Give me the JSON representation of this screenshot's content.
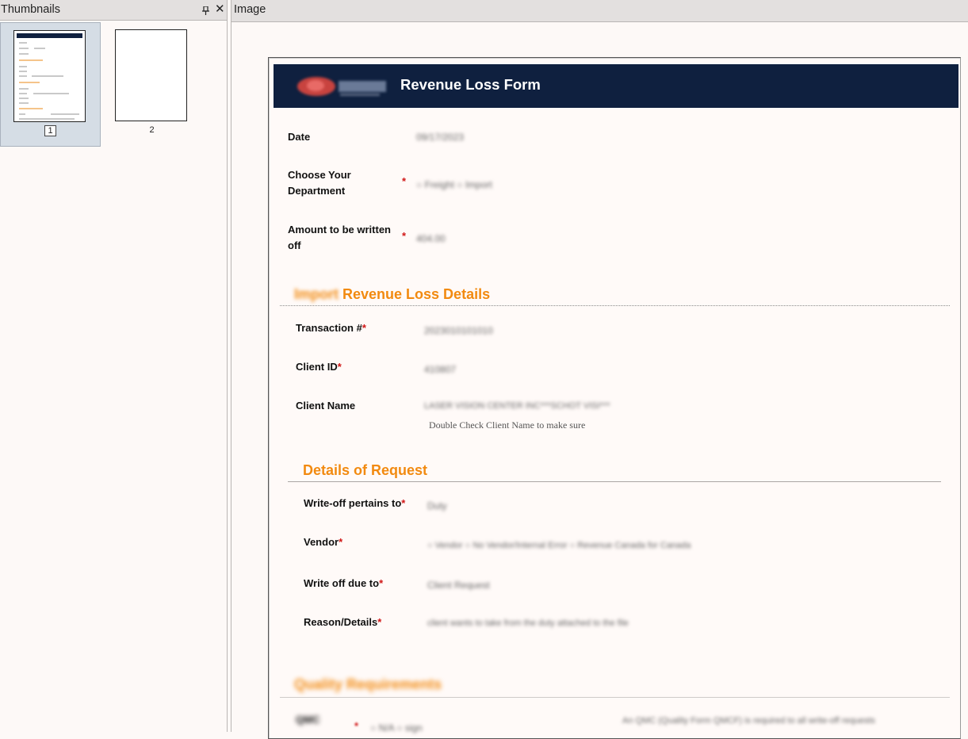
{
  "thumbnails_pane": {
    "title": "Thumbnails",
    "pin_icon": "pin-icon",
    "close_icon": "close-icon",
    "pages": [
      {
        "number": "1",
        "selected": true
      },
      {
        "number": "2",
        "selected": false
      }
    ]
  },
  "image_pane": {
    "title": "Image"
  },
  "form": {
    "title": "Revenue Loss Form",
    "colors": {
      "banner": "#0f203f",
      "section": "#f28a10",
      "required": "#d01616"
    },
    "fields_top": [
      {
        "label": "Date",
        "value": "09/17/2023",
        "required": false
      },
      {
        "label": "Choose Your Department",
        "value": "○ Freight  ○ Import",
        "required": true
      },
      {
        "label": "Amount to be written off",
        "value": "404.00",
        "required": true
      }
    ],
    "section1": {
      "prefix": "Import",
      "title": "Revenue Loss Details",
      "fields": [
        {
          "label": "Transaction #",
          "value": "2023010101010",
          "required": true
        },
        {
          "label": "Client ID",
          "value": "410807",
          "required": true
        },
        {
          "label": "Client Name",
          "value": "LASER VISION CENTER INC***SCHOT VISI***",
          "required": false,
          "hint": "Double Check Client Name to make sure"
        }
      ]
    },
    "section2": {
      "title": "Details of Request",
      "fields": [
        {
          "label": "Write-off pertains to",
          "value": "Duty",
          "required": true
        },
        {
          "label": "Vendor",
          "value": "○ Vendor   ○ No Vendor/Internal Error   ○ Revenue Canada for Canada",
          "required": true
        },
        {
          "label": "Write off due to",
          "value": "Client Request",
          "required": true
        },
        {
          "label": "Reason/Details",
          "value": "client wants to take from the duty attached to the file",
          "required": true
        }
      ]
    },
    "section3": {
      "title": "Quality Requirements",
      "field_label": "QMC",
      "field_value": "○ N/A  ○ sign",
      "note": "An QMC (Quality Form QMCF) is required to all write-off requests"
    }
  }
}
